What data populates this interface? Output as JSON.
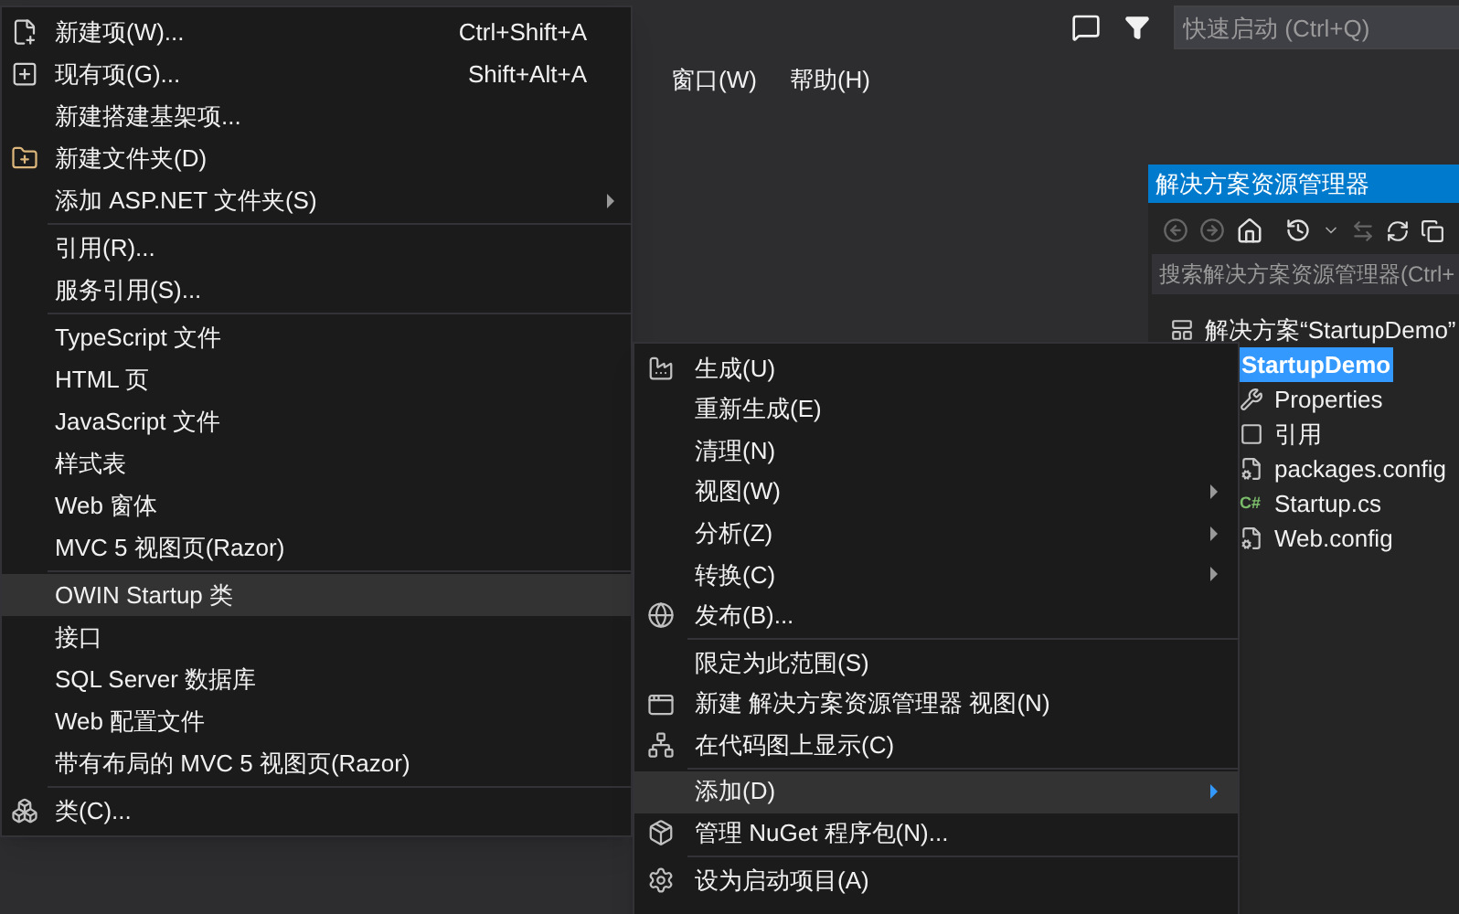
{
  "menu_bar": [
    {
      "label": "窗口(W)"
    },
    {
      "label": "帮助(H)"
    }
  ],
  "quick_launch": {
    "placeholder": "快速启动 (Ctrl+Q)"
  },
  "add_menu": [
    {
      "kind": "item",
      "label": "新建项(W)...",
      "shortcut": "Ctrl+Shift+A",
      "submenu": false,
      "selected": false
    },
    {
      "kind": "item",
      "label": "现有项(G)...",
      "shortcut": "Shift+Alt+A",
      "submenu": false,
      "selected": false
    },
    {
      "kind": "item",
      "label": "新建搭建基架项...",
      "submenu": false,
      "selected": false
    },
    {
      "kind": "item",
      "label": "新建文件夹(D)",
      "submenu": false,
      "selected": false
    },
    {
      "kind": "item",
      "label": "添加 ASP.NET 文件夹(S)",
      "submenu": true,
      "selected": false
    },
    {
      "kind": "separator"
    },
    {
      "kind": "item",
      "label": "引用(R)...",
      "submenu": false,
      "selected": false
    },
    {
      "kind": "item",
      "label": "服务引用(S)...",
      "submenu": false,
      "selected": false
    },
    {
      "kind": "separator"
    },
    {
      "kind": "item",
      "label": "TypeScript 文件",
      "submenu": false,
      "selected": false
    },
    {
      "kind": "item",
      "label": "HTML 页",
      "submenu": false,
      "selected": false
    },
    {
      "kind": "item",
      "label": "JavaScript 文件",
      "submenu": false,
      "selected": false
    },
    {
      "kind": "item",
      "label": "样式表",
      "submenu": false,
      "selected": false
    },
    {
      "kind": "item",
      "label": "Web 窗体",
      "submenu": false,
      "selected": false
    },
    {
      "kind": "item",
      "label": "MVC 5 视图页(Razor)",
      "submenu": false,
      "selected": false
    },
    {
      "kind": "separator"
    },
    {
      "kind": "item",
      "label": "OWIN Startup 类",
      "submenu": false,
      "selected": true
    },
    {
      "kind": "item",
      "label": "接口",
      "submenu": false,
      "selected": false
    },
    {
      "kind": "item",
      "label": "SQL Server 数据库",
      "submenu": false,
      "selected": false
    },
    {
      "kind": "item",
      "label": "Web 配置文件",
      "submenu": false,
      "selected": false
    },
    {
      "kind": "item",
      "label": "带有布局的 MVC 5 视图页(Razor)",
      "submenu": false,
      "selected": false
    },
    {
      "kind": "separator"
    },
    {
      "kind": "item",
      "label": "类(C)...",
      "submenu": false,
      "selected": false
    }
  ],
  "solution_explorer": {
    "title": "解决方案资源管理器",
    "search": {
      "placeholder": "搜索解决方案资源管理器(Ctrl+"
    },
    "tree": [
      {
        "label": "解决方案“StartupDemo”",
        "selected": false,
        "children": [
          {
            "label": "StartupDemo",
            "selected": true,
            "children": [
              {
                "label": "Properties",
                "selected": false
              },
              {
                "label": "引用",
                "selected": false
              },
              {
                "label": "packages.config",
                "selected": false
              },
              {
                "label": "Startup.cs",
                "badge": "C#",
                "selected": false
              },
              {
                "label": "Web.config",
                "selected": false
              }
            ]
          }
        ]
      }
    ]
  },
  "project_menu": [
    {
      "kind": "item",
      "label": "生成(U)",
      "submenu": false,
      "selected": false
    },
    {
      "kind": "item",
      "label": "重新生成(E)",
      "submenu": false,
      "selected": false
    },
    {
      "kind": "item",
      "label": "清理(N)",
      "submenu": false,
      "selected": false
    },
    {
      "kind": "item",
      "label": "视图(W)",
      "submenu": true,
      "selected": false
    },
    {
      "kind": "item",
      "label": "分析(Z)",
      "submenu": true,
      "selected": false
    },
    {
      "kind": "item",
      "label": "转换(C)",
      "submenu": true,
      "selected": false
    },
    {
      "kind": "item",
      "label": "发布(B)...",
      "submenu": false,
      "selected": false
    },
    {
      "kind": "separator"
    },
    {
      "kind": "item",
      "label": "限定为此范围(S)",
      "submenu": false,
      "selected": false
    },
    {
      "kind": "item",
      "label": "新建 解决方案资源管理器 视图(N)",
      "submenu": false,
      "selected": false
    },
    {
      "kind": "item",
      "label": "在代码图上显示(C)",
      "submenu": false,
      "selected": false
    },
    {
      "kind": "separator"
    },
    {
      "kind": "item",
      "label": "添加(D)",
      "submenu": true,
      "selected": true
    },
    {
      "kind": "item",
      "label": "管理 NuGet 程序包(N)...",
      "submenu": false,
      "selected": false
    },
    {
      "kind": "separator"
    },
    {
      "kind": "item",
      "label": "设为启动项目(A)",
      "submenu": false,
      "selected": false
    }
  ]
}
